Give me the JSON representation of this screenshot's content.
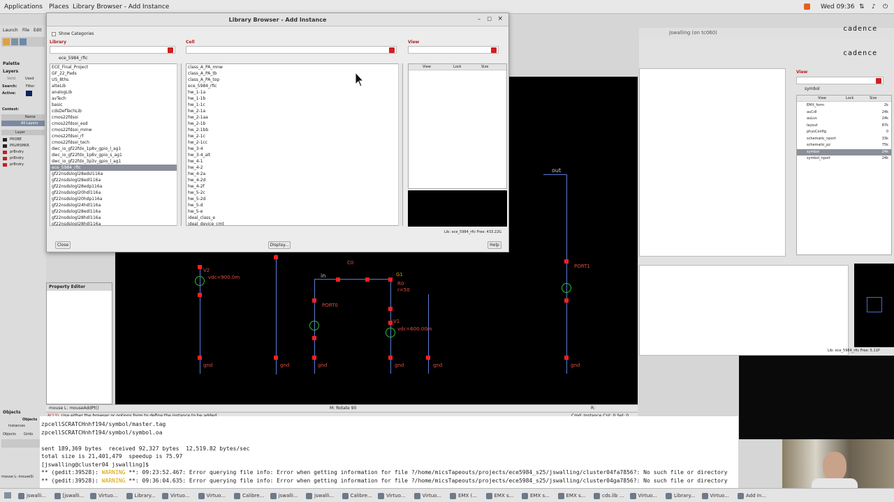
{
  "topbar": {
    "applications": "Applications",
    "places": "Places",
    "active_window": "Library Browser - Add Instance",
    "clock": "Wed 09:36"
  },
  "dialog": {
    "title": "Library Browser - Add Instance",
    "show_categories": "Show Categories",
    "library_label": "Library",
    "cell_label": "Cell",
    "view_label": "View",
    "library_filter": "ece_5984_rfic",
    "libraries": [
      "ECE_Final_Project",
      "GF_22_Pads",
      "US_8ths",
      "alteLib",
      "analogLib",
      "avTech",
      "basic",
      "cdsDefTechLib",
      "cmos22fdsoi",
      "cmos22fdsoi_esd",
      "cmos22fdsoi_mmw",
      "cmos22fdsoi_rf",
      "cmos22fdsoi_tech",
      "dwc_io_gf22fdx_1p8v_gpio_l_ag1",
      "dwc_io_gf22fdx_1p8v_gpio_s_ag1",
      "dwc_io_gf22fdx_3p3v_gpio_l_ag1",
      "ece_5984_rfic",
      "gf22nsdslogl28edsl116a",
      "gf22nsdslogl28edl116a",
      "gf22nsdslogl28edp116a",
      "gf22nsdslogl20hdl116a",
      "gf22nsdslogl20hdp116a",
      "gf22nsdslogl24hdl116a",
      "gf22nsdslogl28edl116a",
      "gf22nsdslogl28hdl116a",
      "gf22nsdslogl28hdl116a"
    ],
    "library_selected_index": 16,
    "cells": [
      "class_A_PA_mnw",
      "class_A_PA_tb",
      "class_A_PA_top",
      "ece_5984_rfic",
      "hw_1-1a",
      "hw_1-1b",
      "hw_1-1c",
      "hw_2-1a",
      "hw_2-1aa",
      "hw_2-1b",
      "hw_2-1bb",
      "hw_2-1c",
      "hw_2-1cc",
      "hw_3-4",
      "hw_3-4_alt",
      "hw_4-1",
      "hw_4-2",
      "hw_4-2a",
      "hw_4-2d",
      "hw_4-2f",
      "hw_5-2c",
      "hw_5-2d",
      "hw_5-d",
      "hw_5-e",
      "ideal_class_e",
      "ideal_device_cmt"
    ],
    "view_columns": [
      "View",
      "Lock",
      "Size"
    ],
    "footer_info": "Lib: ece_5984_rfic   Free: 433.22G",
    "close_button": "Close",
    "display_button": "Display...",
    "help_button": "Help"
  },
  "left_panel": {
    "menu": [
      "Launch",
      "File",
      "Edit"
    ],
    "palette": "Palette",
    "layers": "Layers",
    "valid": "Valid",
    "used": "Used",
    "search": "Search:",
    "filter": "Filter",
    "active": "Active:",
    "context": "Context:",
    "name_col": "Name",
    "layer_col": "Layer",
    "all_layers": "All Layers",
    "layer_items": [
      "PROBE",
      "PRLMSMKR",
      "prBndry",
      "prBndry",
      "prBndry"
    ],
    "objects": "Objects",
    "objects2": "Objects",
    "instances": "Instances",
    "objects_tab": "Objects",
    "grids_tab": "Grids",
    "mouse_status": "mouse L: mouseSi"
  },
  "property_editor": {
    "title": "Property Editor"
  },
  "schematic": {
    "labels": {
      "out": "out",
      "in": "in",
      "g1": "G1",
      "port0": "PORT0",
      "port1": "PORT1",
      "v2": "V2",
      "v1": "V1",
      "r0": "R0",
      "c0": "C0",
      "r50": "r=50",
      "vdc1": "vdc=900.0m",
      "vdc2": "vdc=600.00m",
      "gnd": "gnd"
    },
    "status_left": "mouse L: mouseAddPt()",
    "status_mid": "M: Rotate 90",
    "status_right": "R: schHiMousePopUp()",
    "prompt_number": "8(13)",
    "prompt_text": "Use either the browser or options form to define the instance to be added.",
    "cmd": "Cmd: Instance   Cnt: 0   Sel: 0"
  },
  "right_window": {
    "brand": "cadence",
    "title": "jswalling (on tc060)",
    "view_label": "View",
    "view_filter": "symbol",
    "columns": [
      "View",
      "Lock",
      "Size"
    ],
    "views": [
      {
        "name": "EMX_form",
        "lock": "",
        "size": "2k"
      },
      {
        "name": "auCdl",
        "lock": "",
        "size": "24k"
      },
      {
        "name": "auLvs",
        "lock": "",
        "size": "24k"
      },
      {
        "name": "layout",
        "lock": "",
        "size": "87k"
      },
      {
        "name": "physConfig",
        "lock": "",
        "size": "0"
      },
      {
        "name": "schematic_nport",
        "lock": "",
        "size": "33k"
      },
      {
        "name": "schematic_pz",
        "lock": "",
        "size": "75k"
      },
      {
        "name": "symbol",
        "lock": "",
        "size": "24k"
      },
      {
        "name": "symbol_nport",
        "lock": "",
        "size": "24k"
      }
    ],
    "selected_index": 7,
    "footer": "Lib: ece_5984_rfic   Free: 5.11P"
  },
  "terminal": {
    "lines": [
      "zpcellSCRATCHnhf194/symbol/master.tag",
      "zpcellSCRATCHnhf194/symbol/symbol.oa",
      "",
      "sent 189,369 bytes  received 92,327 bytes  12,519.82 bytes/sec",
      "total size is 21,401,479  speedup is 75.97",
      "[jswalling@cluster04 jswalling]$"
    ],
    "warn1_prefix": "** (gedit:39528): ",
    "warn_word": "WARNING",
    "warn1_suffix": " **: 09:23:52.467: Error querying file info: Error when getting information for file ?/home/micsTapeouts/projects/ece5984_s25/jswalling/cluster04fa7856?: No such file or directory",
    "warn2_suffix": " **: 09:36:04.635: Error querying file info: Error when getting information for file ?/home/micsTapeouts/projects/ece5984_s25/jswalling/cluster04ga7856?: No such file or directory"
  },
  "taskbar": {
    "items": [
      "jswalli...",
      "[jswalli...",
      "Virtuo...",
      "Library...",
      "Virtuo...",
      "Virtuo...",
      "Calibre...",
      "jswalli...",
      "jswalli...",
      "Calibre...",
      "Virtuo...",
      "Virtuo...",
      "EMX (...",
      "EMX s...",
      "EMX s...",
      "EMX s...",
      "cds.lib ...",
      "Virtuo...",
      "Library...",
      "Virtuo...",
      "Add In..."
    ]
  }
}
